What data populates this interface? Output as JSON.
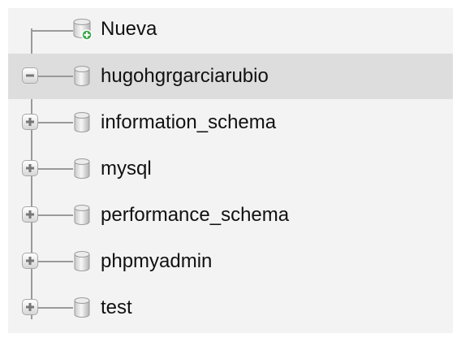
{
  "navigation_tree": {
    "new_item": {
      "label": "Nueva",
      "icon": "database-add-icon"
    },
    "databases": [
      {
        "label": "hugohgrgarciarubio",
        "expanded": true,
        "selected": true,
        "icon": "database-icon"
      },
      {
        "label": "information_schema",
        "expanded": false,
        "selected": false,
        "icon": "database-icon"
      },
      {
        "label": "mysql",
        "expanded": false,
        "selected": false,
        "icon": "database-icon"
      },
      {
        "label": "performance_schema",
        "expanded": false,
        "selected": false,
        "icon": "database-icon"
      },
      {
        "label": "phpmyadmin",
        "expanded": false,
        "selected": false,
        "icon": "database-icon"
      },
      {
        "label": "test",
        "expanded": false,
        "selected": false,
        "icon": "database-icon"
      }
    ]
  },
  "colors": {
    "panel_background": "#f3f3f3",
    "selected_row": "#dddddd",
    "tree_line": "#9a9a9a",
    "add_badge": "#3aa648"
  }
}
